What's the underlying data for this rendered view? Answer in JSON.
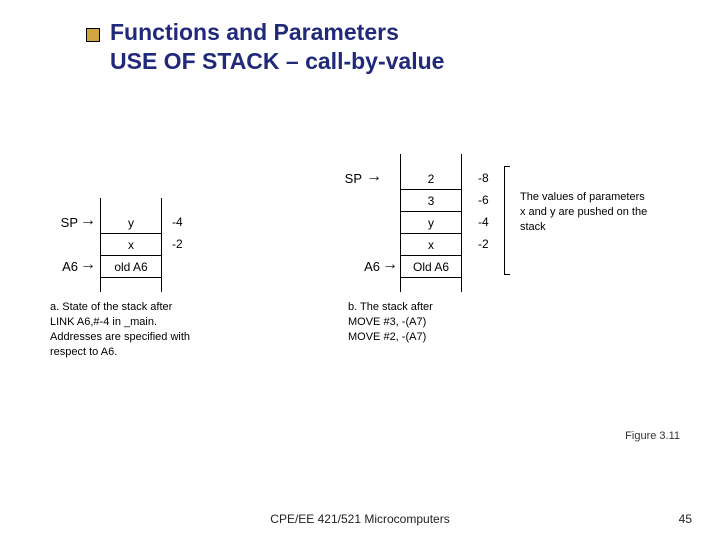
{
  "title_line1": "Functions and Parameters",
  "title_line2": "USE OF STACK – call-by-value",
  "stackA": {
    "sp": "SP",
    "a6": "A6",
    "cells": {
      "y": "y",
      "x": "x",
      "oldA6": "old A6"
    },
    "offsets": {
      "y": "-4",
      "x": "-2"
    }
  },
  "stackB": {
    "sp": "SP",
    "a6": "A6",
    "cells": {
      "v2": "2",
      "v3": "3",
      "y": "y",
      "x": "x",
      "oldA6": "Old A6"
    },
    "offsets": {
      "v2": "-8",
      "v3": "-6",
      "y": "-4",
      "x": "-2"
    }
  },
  "captionA": "a. State of the stack after LINK A6,#-4 in _main. Addresses are specified with respect to A6.",
  "captionB": "b. The stack after\nMOVE #3, -(A7)\nMOVE #2, -(A7)",
  "sideNote": "The values of parameters x and y are pushed on the stack",
  "figLabel": "Figure 3.11",
  "footerCourse": "CPE/EE 421/521 Microcomputers",
  "footerPage": "45"
}
